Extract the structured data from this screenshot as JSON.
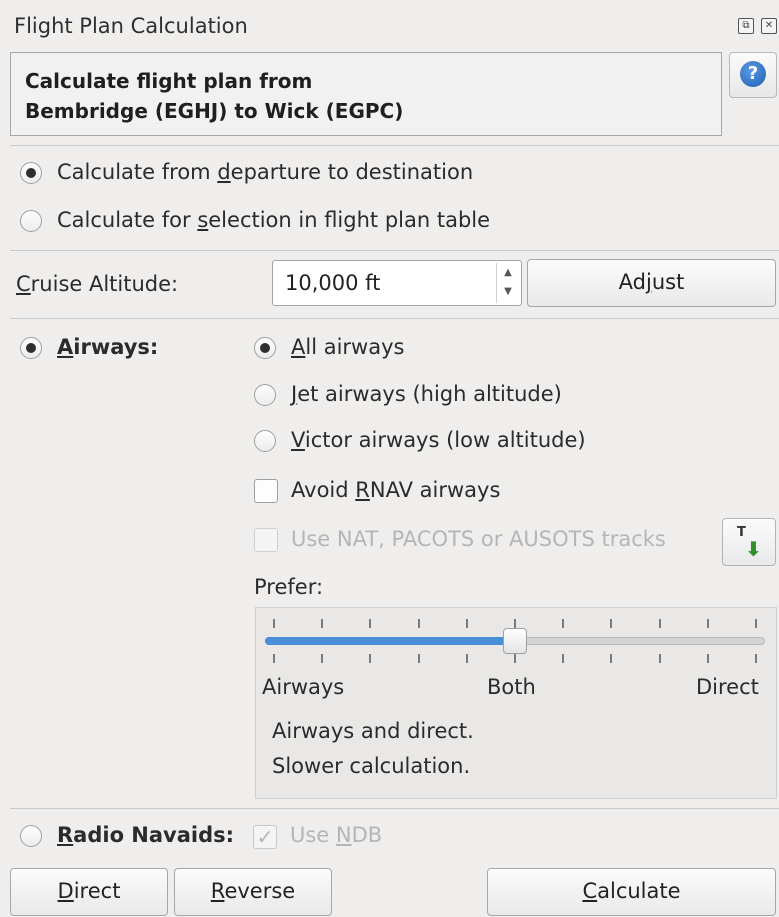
{
  "window": {
    "title": "Flight Plan Calculation"
  },
  "header": {
    "text": "Calculate flight plan from\nBembridge (EGHJ) to Wick (EGPC)",
    "help_icon": "help-icon"
  },
  "mode": {
    "departure_to_destination": {
      "pre": "Calculate from ",
      "ul": "d",
      "post": "eparture to destination",
      "checked": true
    },
    "selection": {
      "pre": "Calculate for ",
      "ul": "s",
      "post": "election in flight plan table",
      "checked": false
    }
  },
  "cruise": {
    "label_ul": "C",
    "label_rest": "ruise Altitude:",
    "value": "10,000 ft",
    "adjust_pre": "Ad",
    "adjust_ul": "j",
    "adjust_post": "ust"
  },
  "airways": {
    "label_ul": "A",
    "label_rest": "irways:",
    "checked": true,
    "options": [
      {
        "ul": "A",
        "rest": "ll airways",
        "checked": true
      },
      {
        "ul": "J",
        "rest": "et airways (high altitude)",
        "checked": false
      },
      {
        "ul": "V",
        "rest": "ictor airways (low altitude)",
        "checked": false
      }
    ],
    "avoid_rnav": {
      "pre": "Avoid ",
      "ul": "R",
      "post": "NAV airways",
      "checked": false
    },
    "tracks": {
      "text": "Use NAT, PACOTS or AUSOTS tracks",
      "enabled": false
    },
    "prefer_label": "Prefer:",
    "slider": {
      "value": 0.5,
      "labels": [
        "Airways",
        "Both",
        "Direct"
      ]
    },
    "description": [
      "Airways and direct.",
      "Slower calculation."
    ]
  },
  "radio_navaids": {
    "label_ul": "R",
    "label_rest": "adio Navaids:",
    "checked": false,
    "use_ndb": {
      "pre": "Use ",
      "ul": "N",
      "post": "DB",
      "checked": true,
      "enabled": false
    }
  },
  "buttons": {
    "direct": {
      "ul": "D",
      "rest": "irect"
    },
    "reverse": {
      "ul": "R",
      "rest": "everse"
    },
    "calculate": {
      "ul": "C",
      "rest": "alculate"
    }
  },
  "colors": {
    "slider_fill": "#4a90d9",
    "background": "#efeeed"
  }
}
